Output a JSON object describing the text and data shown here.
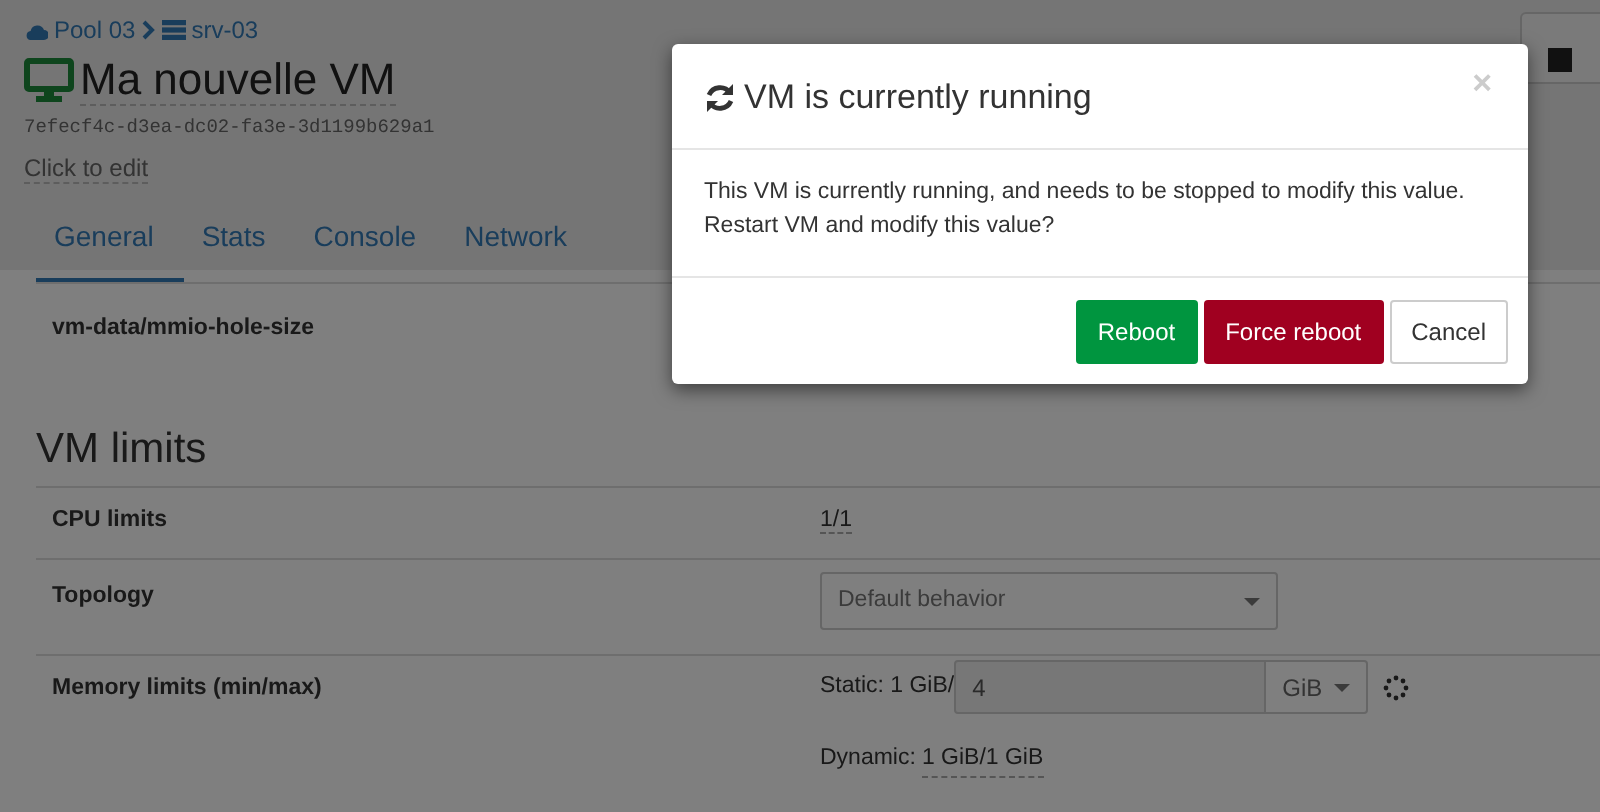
{
  "breadcrumb": [
    {
      "kind": "pool",
      "label": "Pool 03"
    },
    {
      "kind": "host",
      "label": "srv-03"
    }
  ],
  "vm": {
    "name": "Ma nouvelle VM",
    "uuid": "7efecf4c-d3ea-dc02-fa3e-3d1199b629a1",
    "description": "Click to edit",
    "running": true
  },
  "tabs": [
    {
      "label": "General",
      "selected": true
    },
    {
      "label": "Stats",
      "selected": false
    },
    {
      "label": "Console",
      "selected": false
    },
    {
      "label": "Network",
      "selected": false
    }
  ],
  "advanced_row": {
    "label": "vm-data/mmio-hole-size"
  },
  "vm_limits": {
    "title": "VM limits",
    "cpu": {
      "label": "CPU limits",
      "value": "1/1"
    },
    "topology": {
      "label": "Topology",
      "value": "Default behavior"
    },
    "memory": {
      "label": "Memory limits (min/max)",
      "static_label": "Static: 1 GiB/",
      "value": "4",
      "unit": "GiB",
      "loading": true,
      "dynamic_label": "Dynamic:",
      "dynamic_value": "1 GiB/1 GiB"
    }
  },
  "modal": {
    "title": "VM is currently running",
    "close": "×",
    "body": "This VM is currently running, and needs to be stopped to modify this value. Restart VM and modify this value?",
    "buttons": [
      {
        "label": "Reboot",
        "kind": "success"
      },
      {
        "label": "Force reboot",
        "kind": "danger"
      },
      {
        "label": "Cancel",
        "kind": "default"
      }
    ]
  }
}
